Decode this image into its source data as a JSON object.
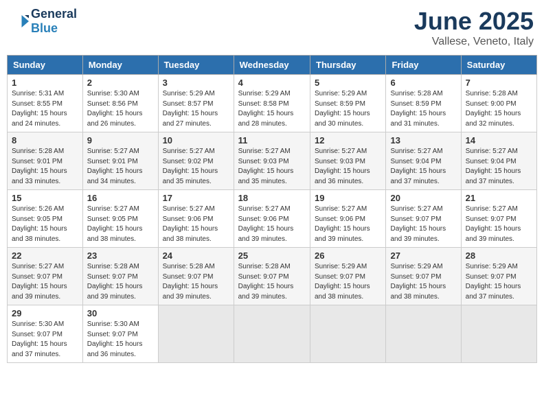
{
  "header": {
    "logo_general": "General",
    "logo_blue": "Blue",
    "month_title": "June 2025",
    "location": "Vallese, Veneto, Italy"
  },
  "weekdays": [
    "Sunday",
    "Monday",
    "Tuesday",
    "Wednesday",
    "Thursday",
    "Friday",
    "Saturday"
  ],
  "weeks": [
    [
      {
        "day": "1",
        "info": "Sunrise: 5:31 AM\nSunset: 8:55 PM\nDaylight: 15 hours\nand 24 minutes."
      },
      {
        "day": "2",
        "info": "Sunrise: 5:30 AM\nSunset: 8:56 PM\nDaylight: 15 hours\nand 26 minutes."
      },
      {
        "day": "3",
        "info": "Sunrise: 5:29 AM\nSunset: 8:57 PM\nDaylight: 15 hours\nand 27 minutes."
      },
      {
        "day": "4",
        "info": "Sunrise: 5:29 AM\nSunset: 8:58 PM\nDaylight: 15 hours\nand 28 minutes."
      },
      {
        "day": "5",
        "info": "Sunrise: 5:29 AM\nSunset: 8:59 PM\nDaylight: 15 hours\nand 30 minutes."
      },
      {
        "day": "6",
        "info": "Sunrise: 5:28 AM\nSunset: 8:59 PM\nDaylight: 15 hours\nand 31 minutes."
      },
      {
        "day": "7",
        "info": "Sunrise: 5:28 AM\nSunset: 9:00 PM\nDaylight: 15 hours\nand 32 minutes."
      }
    ],
    [
      {
        "day": "8",
        "info": "Sunrise: 5:28 AM\nSunset: 9:01 PM\nDaylight: 15 hours\nand 33 minutes."
      },
      {
        "day": "9",
        "info": "Sunrise: 5:27 AM\nSunset: 9:01 PM\nDaylight: 15 hours\nand 34 minutes."
      },
      {
        "day": "10",
        "info": "Sunrise: 5:27 AM\nSunset: 9:02 PM\nDaylight: 15 hours\nand 35 minutes."
      },
      {
        "day": "11",
        "info": "Sunrise: 5:27 AM\nSunset: 9:03 PM\nDaylight: 15 hours\nand 35 minutes."
      },
      {
        "day": "12",
        "info": "Sunrise: 5:27 AM\nSunset: 9:03 PM\nDaylight: 15 hours\nand 36 minutes."
      },
      {
        "day": "13",
        "info": "Sunrise: 5:27 AM\nSunset: 9:04 PM\nDaylight: 15 hours\nand 37 minutes."
      },
      {
        "day": "14",
        "info": "Sunrise: 5:27 AM\nSunset: 9:04 PM\nDaylight: 15 hours\nand 37 minutes."
      }
    ],
    [
      {
        "day": "15",
        "info": "Sunrise: 5:26 AM\nSunset: 9:05 PM\nDaylight: 15 hours\nand 38 minutes."
      },
      {
        "day": "16",
        "info": "Sunrise: 5:27 AM\nSunset: 9:05 PM\nDaylight: 15 hours\nand 38 minutes."
      },
      {
        "day": "17",
        "info": "Sunrise: 5:27 AM\nSunset: 9:06 PM\nDaylight: 15 hours\nand 38 minutes."
      },
      {
        "day": "18",
        "info": "Sunrise: 5:27 AM\nSunset: 9:06 PM\nDaylight: 15 hours\nand 39 minutes."
      },
      {
        "day": "19",
        "info": "Sunrise: 5:27 AM\nSunset: 9:06 PM\nDaylight: 15 hours\nand 39 minutes."
      },
      {
        "day": "20",
        "info": "Sunrise: 5:27 AM\nSunset: 9:07 PM\nDaylight: 15 hours\nand 39 minutes."
      },
      {
        "day": "21",
        "info": "Sunrise: 5:27 AM\nSunset: 9:07 PM\nDaylight: 15 hours\nand 39 minutes."
      }
    ],
    [
      {
        "day": "22",
        "info": "Sunrise: 5:27 AM\nSunset: 9:07 PM\nDaylight: 15 hours\nand 39 minutes."
      },
      {
        "day": "23",
        "info": "Sunrise: 5:28 AM\nSunset: 9:07 PM\nDaylight: 15 hours\nand 39 minutes."
      },
      {
        "day": "24",
        "info": "Sunrise: 5:28 AM\nSunset: 9:07 PM\nDaylight: 15 hours\nand 39 minutes."
      },
      {
        "day": "25",
        "info": "Sunrise: 5:28 AM\nSunset: 9:07 PM\nDaylight: 15 hours\nand 39 minutes."
      },
      {
        "day": "26",
        "info": "Sunrise: 5:29 AM\nSunset: 9:07 PM\nDaylight: 15 hours\nand 38 minutes."
      },
      {
        "day": "27",
        "info": "Sunrise: 5:29 AM\nSunset: 9:07 PM\nDaylight: 15 hours\nand 38 minutes."
      },
      {
        "day": "28",
        "info": "Sunrise: 5:29 AM\nSunset: 9:07 PM\nDaylight: 15 hours\nand 37 minutes."
      }
    ],
    [
      {
        "day": "29",
        "info": "Sunrise: 5:30 AM\nSunset: 9:07 PM\nDaylight: 15 hours\nand 37 minutes."
      },
      {
        "day": "30",
        "info": "Sunrise: 5:30 AM\nSunset: 9:07 PM\nDaylight: 15 hours\nand 36 minutes."
      },
      null,
      null,
      null,
      null,
      null
    ]
  ]
}
